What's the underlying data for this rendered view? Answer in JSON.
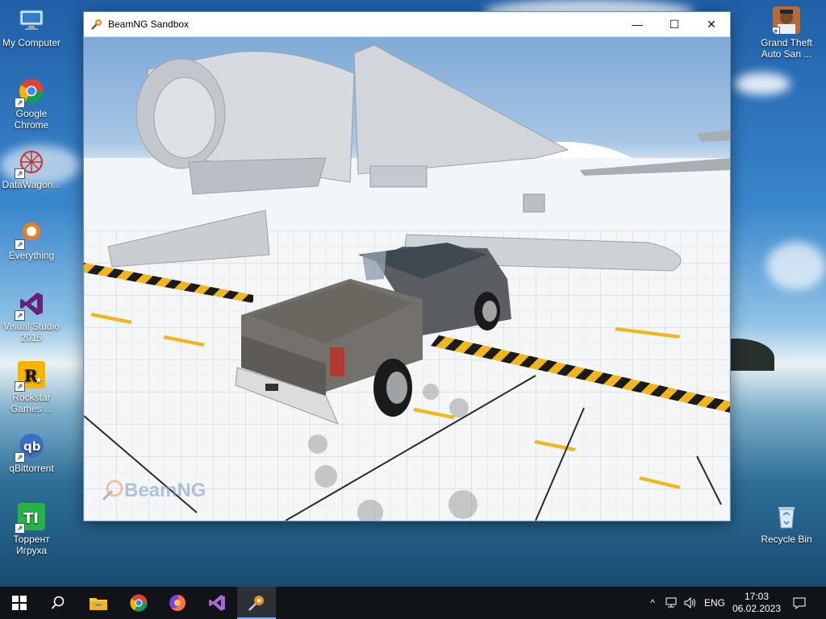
{
  "desktop": {
    "icons": [
      {
        "label": "My Computer",
        "icon": "computer-icon"
      },
      {
        "label": "Google Chrome",
        "icon": "chrome-icon"
      },
      {
        "label": "DataWagon...",
        "icon": "datawagon-icon"
      },
      {
        "label": "Everything",
        "icon": "everything-icon"
      },
      {
        "label": "Visual Studio 2015",
        "icon": "visual-studio-icon"
      },
      {
        "label": "Rockstar Games ...",
        "icon": "rockstar-icon"
      },
      {
        "label": "qBittorrent",
        "icon": "qbittorrent-icon"
      },
      {
        "label": "Торрент Игруха",
        "icon": "torrent-igruha-icon"
      },
      {
        "label": "Grand Theft Auto San ...",
        "icon": "gta-san-andreas-icon"
      },
      {
        "label": "Recycle Bin",
        "icon": "recycle-bin-icon"
      }
    ]
  },
  "window": {
    "title": "BeamNG Sandbox",
    "minimize_symbol": "—",
    "maximize_symbol": "☐",
    "close_symbol": "✕",
    "watermark": "BeamNG"
  },
  "taskbar": {
    "pinned": [
      "windows-start-icon",
      "search-icon",
      "file-explorer-icon",
      "chrome-icon",
      "firefox-icon",
      "visual-studio-icon",
      "beamng-icon"
    ],
    "tray": {
      "chevron": "^",
      "language": "ENG",
      "time": "17:03",
      "date": "06.02.2023"
    }
  },
  "colors": {
    "taskbar": "#101418",
    "accent": "#7ab4f0",
    "hazard_yellow": "#f2b51b"
  }
}
